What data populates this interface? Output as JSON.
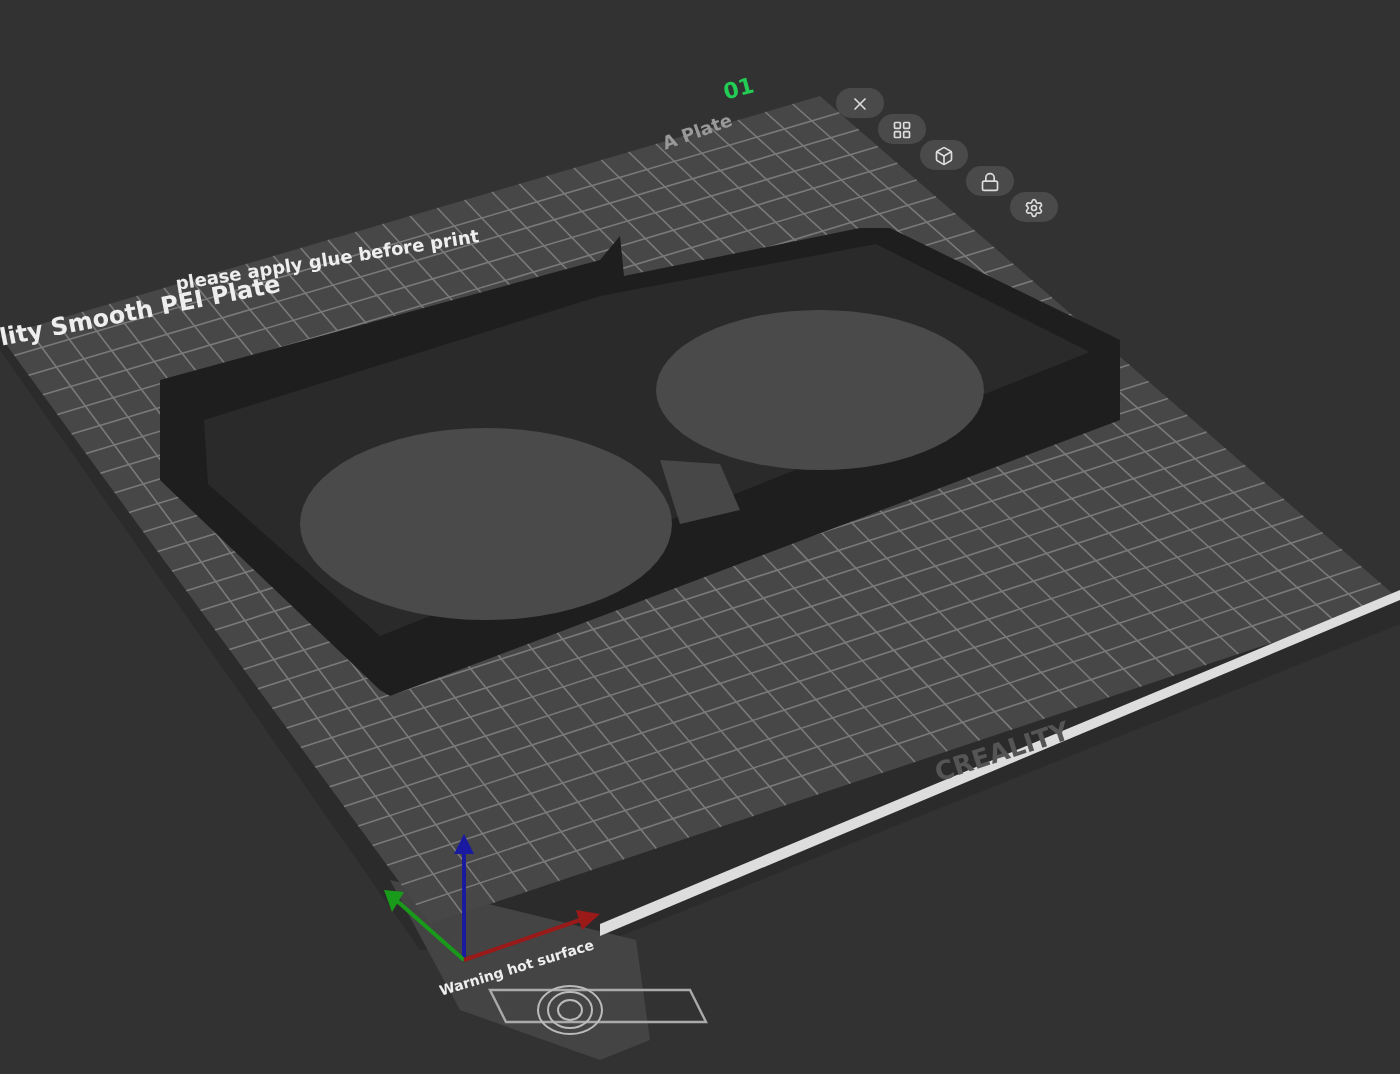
{
  "plate": {
    "number": "01",
    "name": "A Plate",
    "notice": "please apply glue before print",
    "plate_type": "lity Smooth PEI Plate",
    "brand": "CREALITY",
    "warning": "Warning hot surface"
  },
  "toolbar": [
    {
      "kind": "close"
    },
    {
      "kind": "arrange"
    },
    {
      "kind": "orient"
    },
    {
      "kind": "lock"
    },
    {
      "kind": "settings"
    }
  ]
}
